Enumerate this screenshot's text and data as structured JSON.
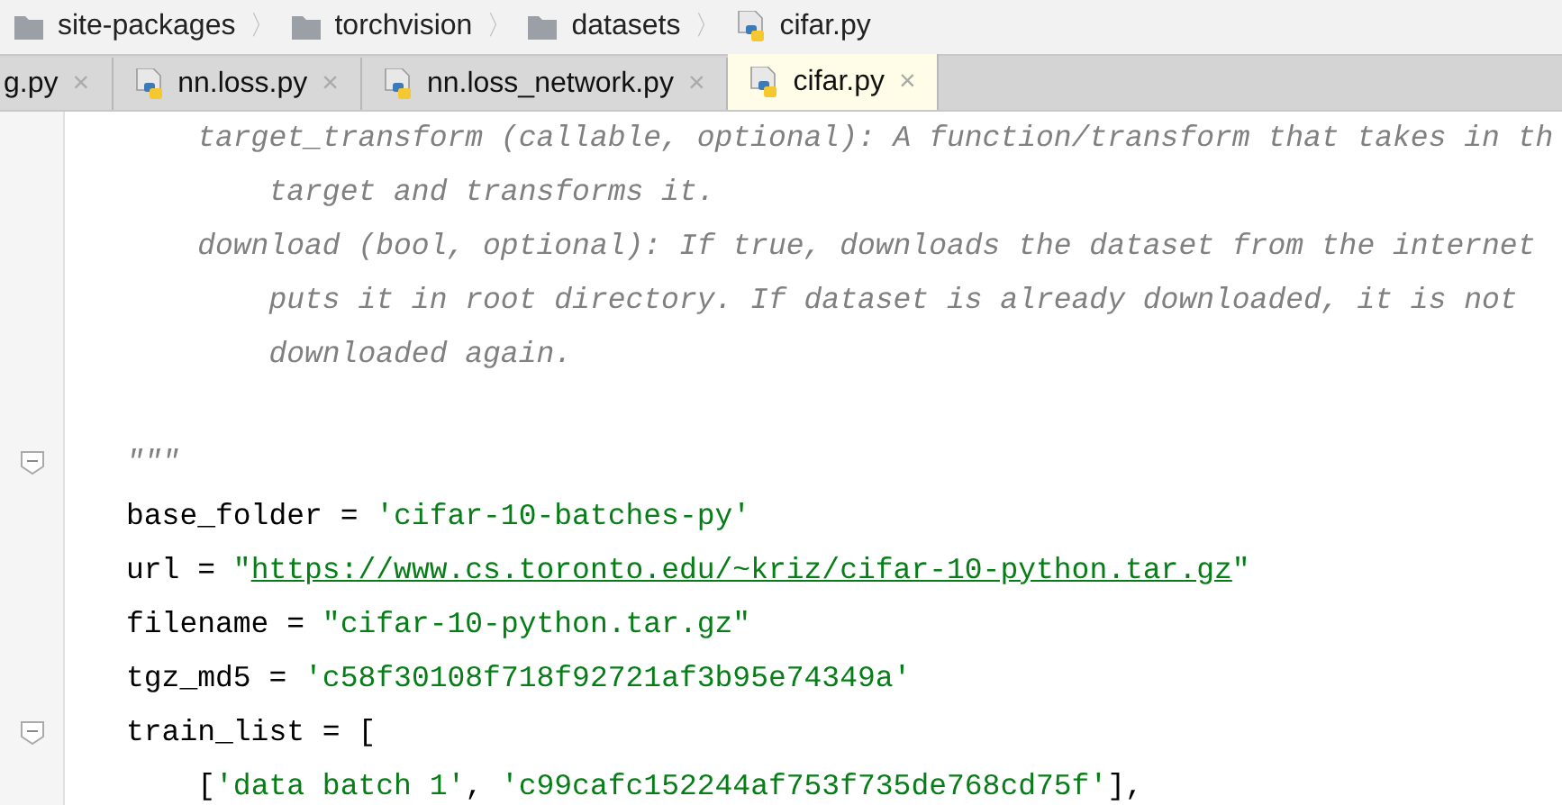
{
  "breadcrumb": [
    {
      "kind": "folder",
      "label": "site-packages"
    },
    {
      "kind": "folder",
      "label": "torchvision"
    },
    {
      "kind": "folder",
      "label": "datasets"
    },
    {
      "kind": "python",
      "label": "cifar.py"
    }
  ],
  "separator": "〉",
  "close": "×",
  "tabs": [
    {
      "label": "g.py",
      "selected": false,
      "icon": false
    },
    {
      "label": "nn.loss.py",
      "selected": false,
      "icon": true
    },
    {
      "label": "nn.loss_network.py",
      "selected": false,
      "icon": true
    },
    {
      "label": "cifar.py",
      "selected": true,
      "icon": true
    }
  ],
  "code_lines": [
    {
      "fold": false,
      "segments": [
        {
          "kind": "doc",
          "text": "    target_transform (callable, optional): A function/transform that takes in th"
        }
      ]
    },
    {
      "fold": false,
      "segments": [
        {
          "kind": "doc",
          "text": "        target and transforms it."
        }
      ]
    },
    {
      "fold": false,
      "segments": [
        {
          "kind": "doc",
          "text": "    download (bool, optional): If true, downloads the dataset from the internet"
        }
      ]
    },
    {
      "fold": false,
      "segments": [
        {
          "kind": "doc",
          "text": "        puts it in root directory. If dataset is already downloaded, it is not"
        }
      ]
    },
    {
      "fold": false,
      "segments": [
        {
          "kind": "doc",
          "text": "        downloaded again."
        }
      ]
    },
    {
      "kind": "blank"
    },
    {
      "fold": true,
      "segments": [
        {
          "kind": "doc",
          "text": "\"\"\""
        }
      ]
    },
    {
      "fold": false,
      "segments": [
        {
          "kind": "plain",
          "text": "base_folder = "
        },
        {
          "kind": "string",
          "text": "'cifar-10-batches-py'"
        }
      ]
    },
    {
      "fold": false,
      "segments": [
        {
          "kind": "plain",
          "text": "url = "
        },
        {
          "kind": "string",
          "text": "\""
        },
        {
          "kind": "url",
          "text": "https://www.cs.toronto.edu/~kriz/cifar-10-python.tar.gz"
        },
        {
          "kind": "string",
          "text": "\""
        }
      ]
    },
    {
      "fold": false,
      "segments": [
        {
          "kind": "plain",
          "text": "filename = "
        },
        {
          "kind": "string",
          "text": "\"cifar-10-python.tar.gz\""
        }
      ]
    },
    {
      "fold": false,
      "segments": [
        {
          "kind": "plain",
          "text": "tgz_md5 = "
        },
        {
          "kind": "string",
          "text": "'c58f30108f718f92721af3b95e74349a'"
        }
      ]
    },
    {
      "fold": true,
      "segments": [
        {
          "kind": "plain",
          "text": "train_list = ["
        }
      ]
    },
    {
      "fold": false,
      "segments": [
        {
          "kind": "plain",
          "text": "    ["
        },
        {
          "kind": "string",
          "text": "'data batch 1'"
        },
        {
          "kind": "plain",
          "text": ", "
        },
        {
          "kind": "string",
          "text": "'c99cafc152244af753f735de768cd75f'"
        },
        {
          "kind": "plain",
          "text": "],"
        }
      ]
    }
  ]
}
